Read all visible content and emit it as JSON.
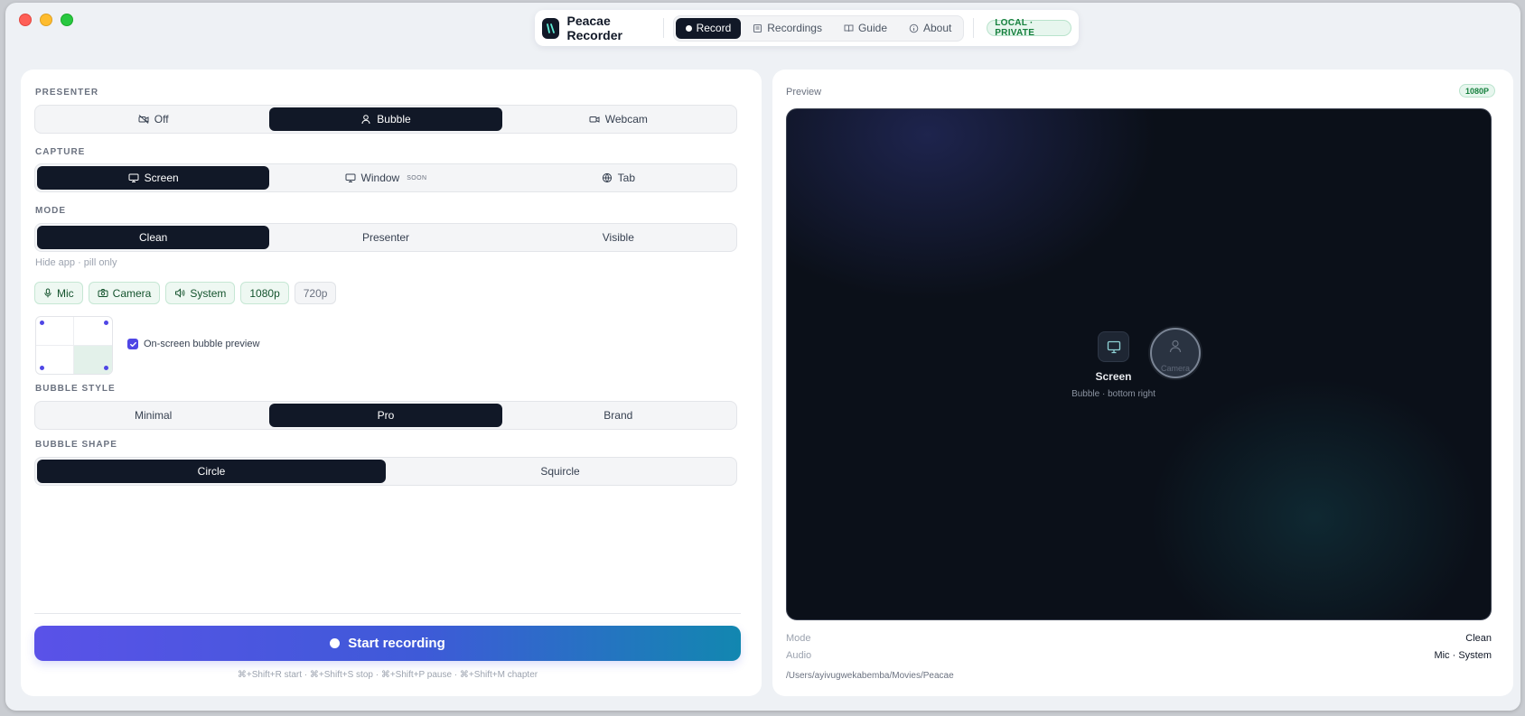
{
  "app": {
    "title": "Peacae Recorder",
    "badge": "LOCAL · PRIVATE"
  },
  "nav": {
    "tabs": [
      {
        "label": "Record",
        "active": true
      },
      {
        "label": "Recordings",
        "active": false
      },
      {
        "label": "Guide",
        "active": false
      },
      {
        "label": "About",
        "active": false
      }
    ]
  },
  "presenter": {
    "label": "PRESENTER",
    "options": [
      "Off",
      "Bubble",
      "Webcam"
    ],
    "selected": "Bubble"
  },
  "capture": {
    "label": "CAPTURE",
    "options": [
      "Screen",
      "Window",
      "Tab"
    ],
    "window_tag": "SOON",
    "selected": "Screen"
  },
  "mode": {
    "label": "MODE",
    "options": [
      "Clean",
      "Presenter",
      "Visible"
    ],
    "selected": "Clean",
    "hint": "Hide app · pill only"
  },
  "chips": [
    {
      "label": "Mic",
      "on": true
    },
    {
      "label": "Camera",
      "on": true
    },
    {
      "label": "System",
      "on": true
    },
    {
      "label": "1080p",
      "on": true
    },
    {
      "label": "720p",
      "on": false
    }
  ],
  "bubble_position": {
    "selected": "bottom-right",
    "preview_checkbox_label": "On-screen bubble preview",
    "preview_checked": true
  },
  "bubble_style": {
    "label": "BUBBLE STYLE",
    "options": [
      "Minimal",
      "Pro",
      "Brand"
    ],
    "selected": "Pro"
  },
  "bubble_shape": {
    "label": "BUBBLE SHAPE",
    "options": [
      "Circle",
      "Squircle"
    ],
    "selected": "Circle"
  },
  "start": {
    "label": "Start recording",
    "shortcuts": "⌘+Shift+R start · ⌘+Shift+S stop · ⌘+Shift+P pause · ⌘+Shift+M chapter"
  },
  "preview": {
    "title": "Preview",
    "resolution_badge": "1080P",
    "screen_label": "Screen",
    "screen_sub": "Bubble · bottom right",
    "camera_label": "Camera",
    "info": [
      {
        "key": "Mode",
        "value": "Clean"
      },
      {
        "key": "Audio",
        "value": "Mic · System"
      }
    ],
    "path": "/Users/ayivugwekabemba/Movies/Peacae"
  },
  "colors": {
    "accent": "#4f46e5",
    "dark": "#111827",
    "success": "#15803d",
    "gradient_start": "#5a52e8",
    "gradient_end": "#1287b0"
  }
}
